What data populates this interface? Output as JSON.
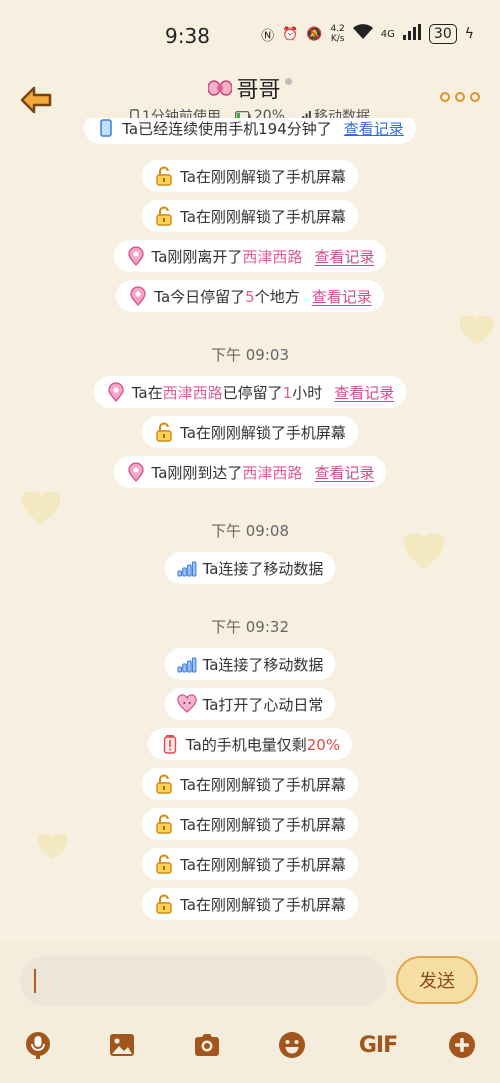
{
  "status": {
    "time": "9:38",
    "speed_value": "4.2",
    "speed_unit": "K/s",
    "network": "4G",
    "battery": "30"
  },
  "header": {
    "title": "哥哥",
    "last_used": "1分钟前使用",
    "battery": "20%",
    "network": "移动数据"
  },
  "feed": {
    "top_cut": "Ta已经连续使用手机194分钟了",
    "top_cut_link": "查看记录",
    "items1": [
      {
        "text": "Ta在刚刚解锁了手机屏幕"
      },
      {
        "text": "Ta在刚刚解锁了手机屏幕"
      }
    ],
    "leave": {
      "pre": "Ta刚刚离开了",
      "place": "西津西路",
      "link": "查看记录"
    },
    "stay_today": {
      "pre": "Ta今日停留了",
      "count": "5",
      "post": "个地方",
      "link": "查看记录"
    },
    "time1": "下午 09:03",
    "stayed": {
      "pre": "Ta在",
      "place": "西津西路",
      "mid": "已停留了",
      "num": "1",
      "post": "小时",
      "link": "查看记录"
    },
    "unlock_a": "Ta在刚刚解锁了手机屏幕",
    "arrive": {
      "pre": "Ta刚刚到达了",
      "place": "西津西路",
      "link": "查看记录"
    },
    "time2": "下午 09:08",
    "mobile1": "Ta连接了移动数据",
    "time3": "下午 09:32",
    "mobile2": "Ta连接了移动数据",
    "heart_app": "Ta打开了心动日常",
    "battery_low": {
      "pre": "Ta的手机电量仅剩",
      "value": "20%"
    },
    "unlocks_end": [
      "Ta在刚刚解锁了手机屏幕",
      "Ta在刚刚解锁了手机屏幕",
      "Ta在刚刚解锁了手机屏幕",
      "Ta在刚刚解锁了手机屏幕"
    ]
  },
  "input": {
    "send_label": "发送",
    "gif_label": "GIF"
  },
  "colors": {
    "background": "#f7f0e1",
    "accent_orange": "#e0922a",
    "highlight_pink": "#e0609e",
    "link_pink": "#d04b90"
  }
}
